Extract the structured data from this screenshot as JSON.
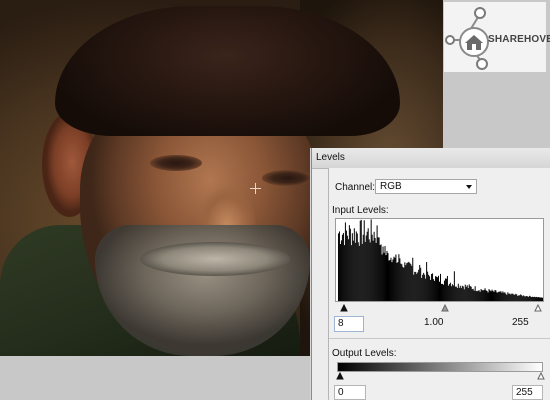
{
  "dialog": {
    "title": "Levels",
    "channel_label": "Channel:",
    "channel_value": "RGB",
    "input_levels_label": "Input Levels:",
    "input_shadow": "8",
    "input_gamma": "1.00",
    "input_highlight": "255",
    "output_levels_label": "Output Levels:",
    "output_low": "0",
    "output_high": "255"
  },
  "logo": {
    "text": "SHAREHOVEL",
    "icon": "house-network-icon"
  },
  "colors": {
    "dialog_bg": "#ececec",
    "histogram_fill": "#000000",
    "input_focus_border": "#9fb4d0"
  }
}
